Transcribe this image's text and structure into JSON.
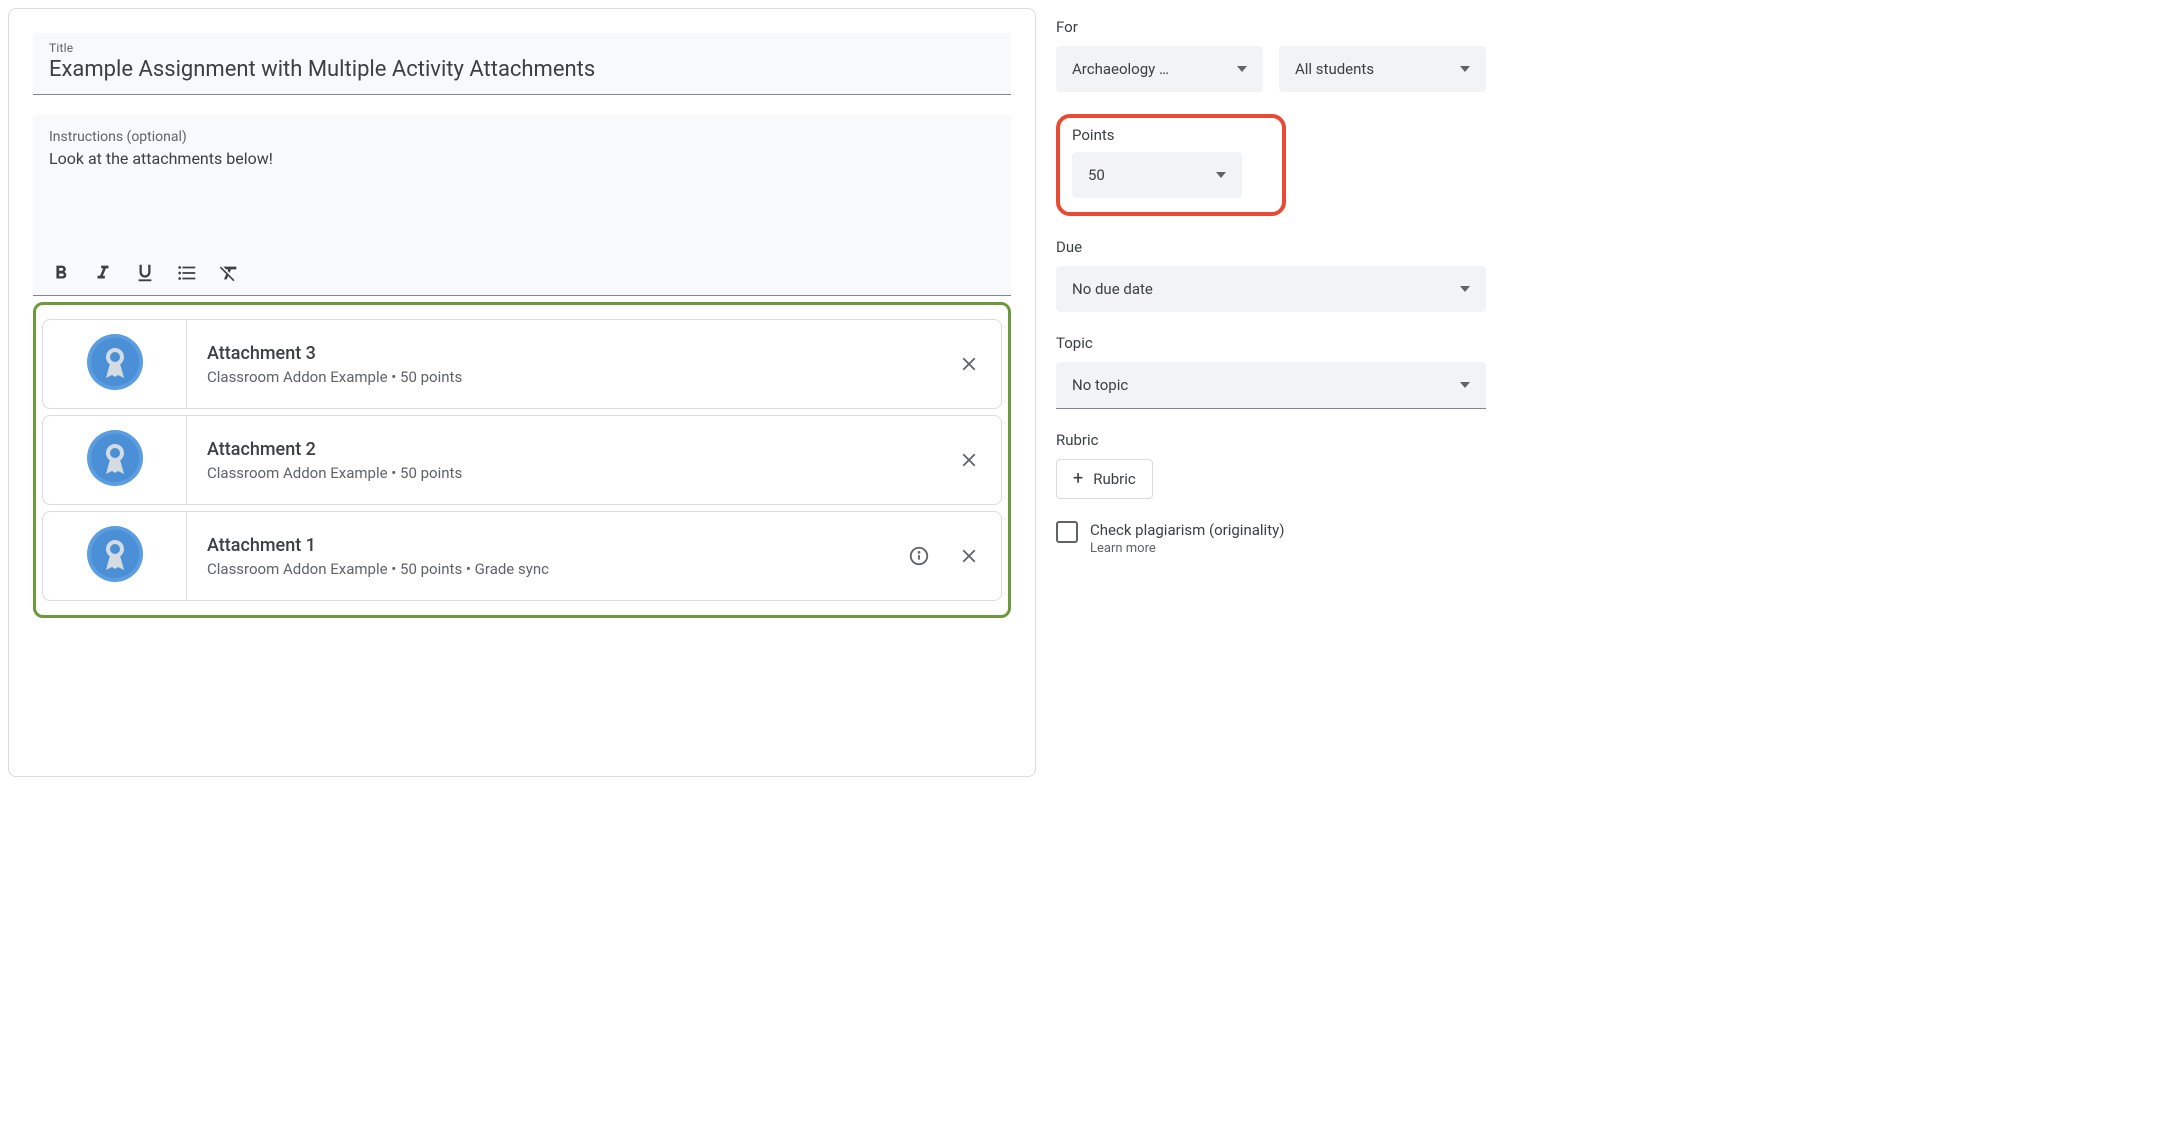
{
  "title_label": "Title",
  "title_value": "Example Assignment with Multiple Activity Attachments",
  "instructions_label": "Instructions (optional)",
  "instructions_value": "Look at the attachments below!",
  "attachments": [
    {
      "title": "Attachment 3",
      "meta": "Classroom Addon Example • 50 points",
      "info": false
    },
    {
      "title": "Attachment 2",
      "meta": "Classroom Addon Example • 50 points",
      "info": false
    },
    {
      "title": "Attachment 1",
      "meta": "Classroom Addon Example • 50 points • Grade sync",
      "info": true
    }
  ],
  "sidebar": {
    "for_label": "For",
    "for_class": "Archaeology …",
    "for_students": "All students",
    "points_label": "Points",
    "points_value": "50",
    "due_label": "Due",
    "due_value": "No due date",
    "topic_label": "Topic",
    "topic_value": "No topic",
    "rubric_label": "Rubric",
    "rubric_button": "Rubric",
    "plagiarism_label": "Check plagiarism (originality)",
    "learn_more": "Learn more"
  }
}
